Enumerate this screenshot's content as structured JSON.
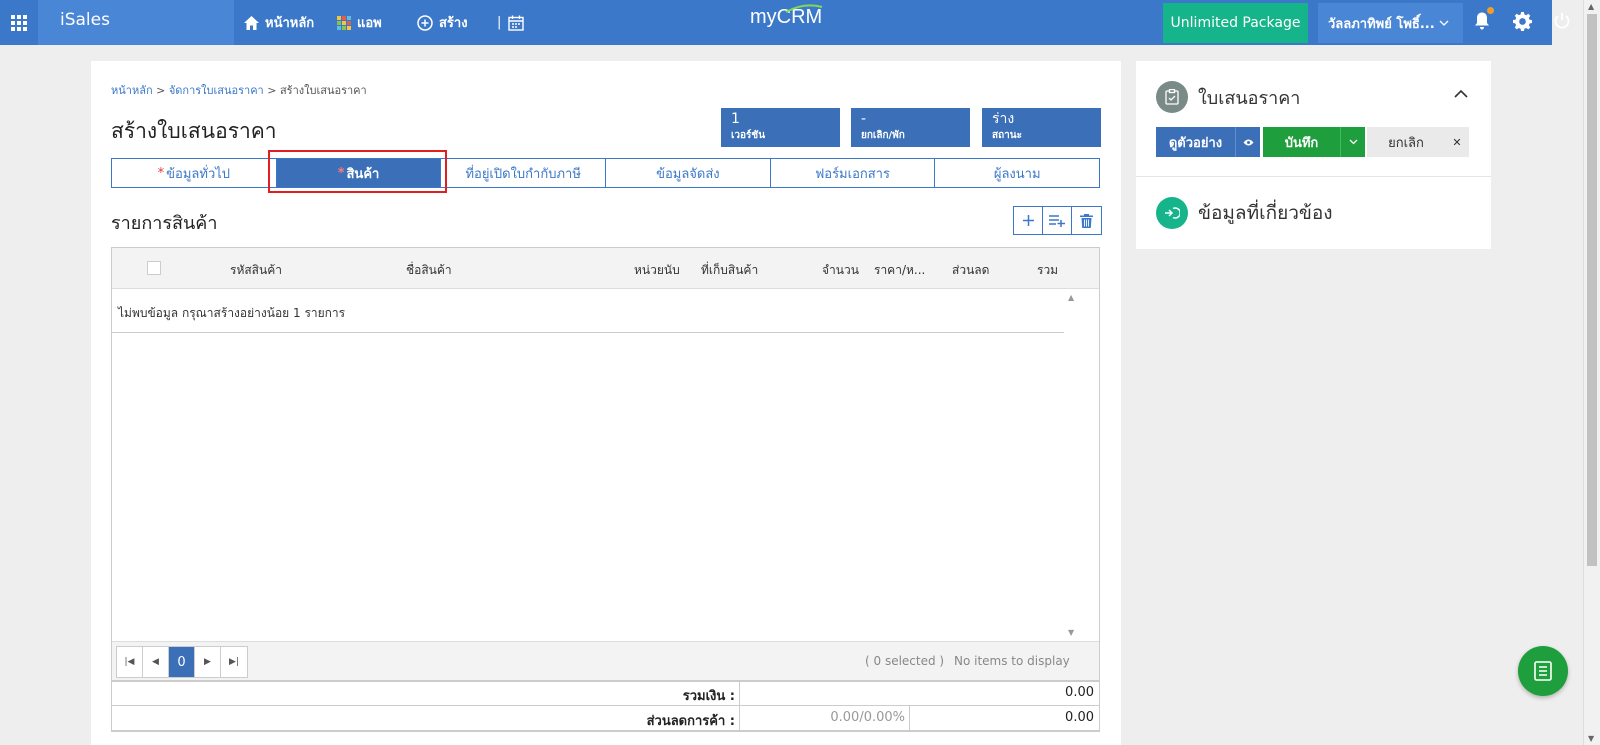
{
  "topbar": {
    "brand": "iSales",
    "nav_home": "หน้าหลัก",
    "nav_apps": "แอพ",
    "nav_create": "สร้าง",
    "logo": "myCRM",
    "package": "Unlimited Package",
    "user": "วัลลภาทิพย์ โพธิ์..."
  },
  "breadcrumb": {
    "home": "หน้าหลัก",
    "sep": ">",
    "manage": "จัดการใบเสนอราคา",
    "current": "สร้างใบเสนอราคา"
  },
  "page_title": "สร้างใบเสนอราคา",
  "stats": [
    {
      "value": "1",
      "label": "เวอร์ชัน"
    },
    {
      "value": "-",
      "label": "ยกเลิก/พัก"
    },
    {
      "value": "ร่าง",
      "label": "สถานะ"
    }
  ],
  "tabs": [
    {
      "label": "ข้อมูลทั่วไป",
      "required": "*"
    },
    {
      "label": "สินค้า",
      "required": "*"
    },
    {
      "label": "ที่อยู่เปิดใบกำกับภาษี"
    },
    {
      "label": "ข้อมูลจัดส่ง"
    },
    {
      "label": "ฟอร์มเอกสาร"
    },
    {
      "label": "ผู้ลงนาม"
    }
  ],
  "section_title": "รายการสินค้า",
  "grid": {
    "columns": [
      "รหัสสินค้า",
      "ชื่อสินค้า",
      "หน่วยนับ",
      "ที่เก็บสินค้า",
      "จำนวน",
      "ราคา/ห...",
      "ส่วนลด",
      "รวม"
    ],
    "empty_message": "ไม่พบข้อมูล กรุณาสร้างอย่างน้อย 1 รายการ",
    "page": "0",
    "selected": "( 0 selected )",
    "no_items": "No items to display"
  },
  "totals": {
    "sum_label": "รวมเงิน :",
    "sum_value": "0.00",
    "discount_label": "ส่วนลดการค้า :",
    "discount_percent": "0.00/0.00%",
    "discount_value": "0.00"
  },
  "side": {
    "title": "ใบเสนอราคา",
    "preview": "ดูตัวอย่าง",
    "save": "บันทึก",
    "cancel": "ยกเลิก",
    "close": "✕",
    "related": "ข้อมูลที่เกี่ยวข้อง"
  },
  "colors": {
    "primary": "#3b78c9",
    "package": "#15b48a",
    "save": "#1e9e3c",
    "highlight": "#e02020"
  }
}
